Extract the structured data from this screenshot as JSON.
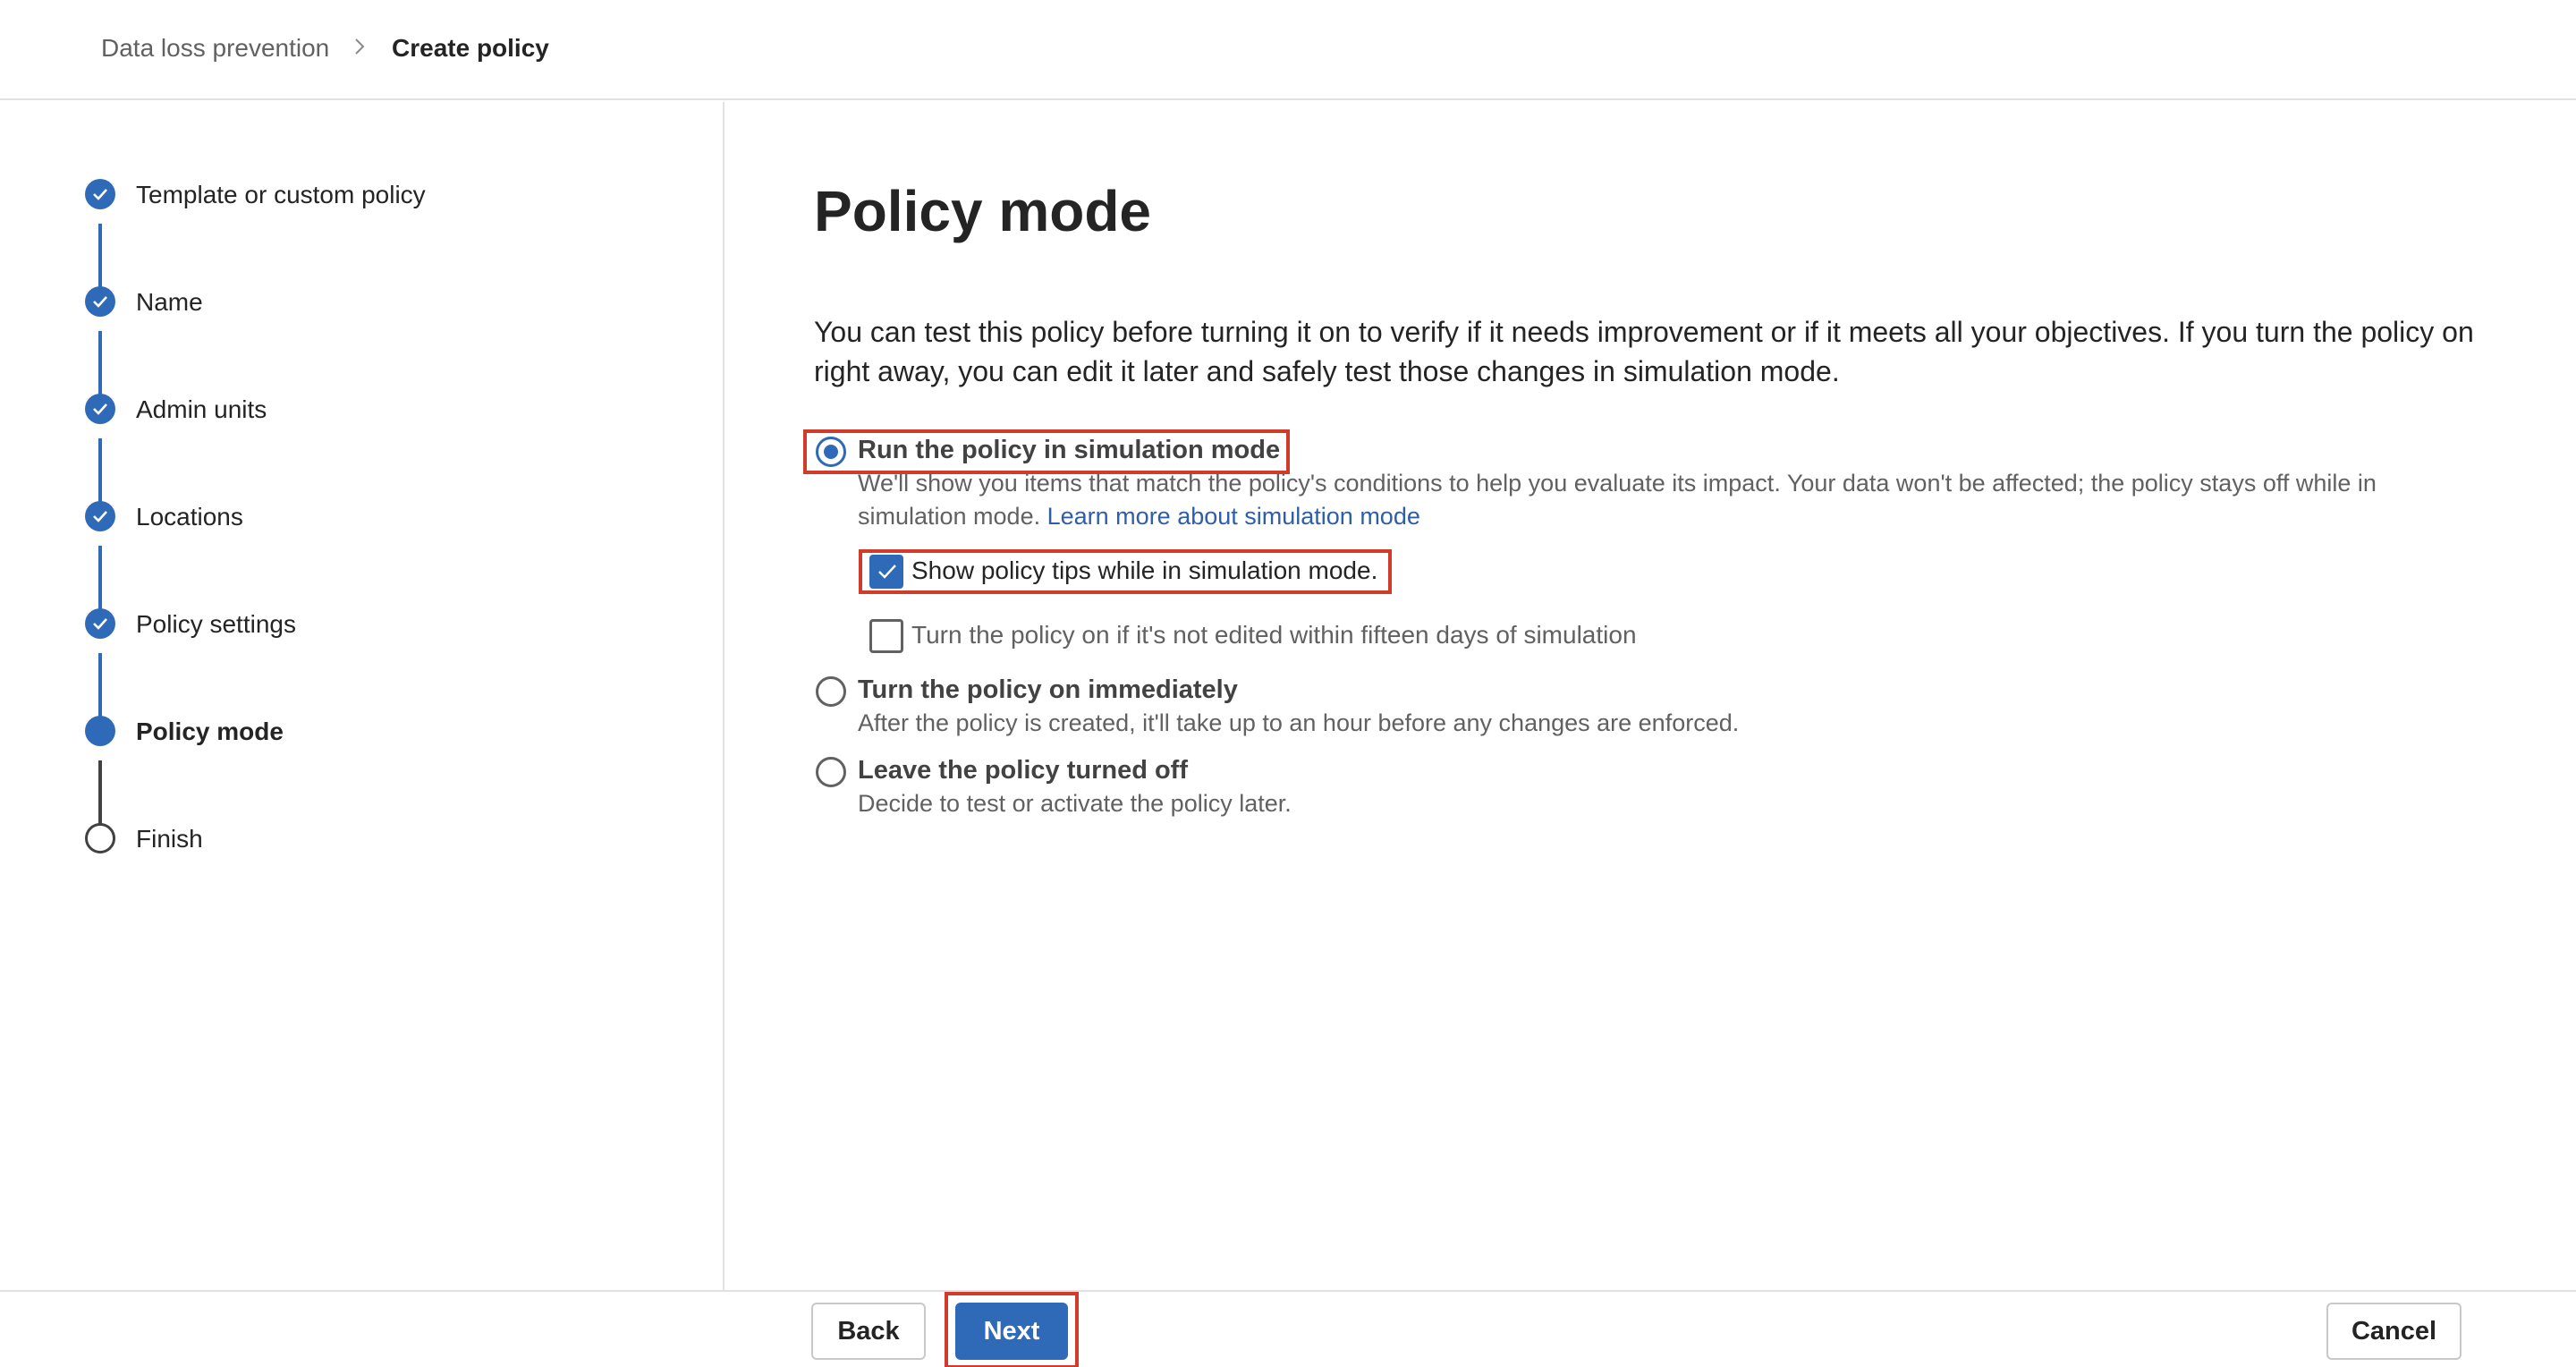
{
  "breadcrumb": {
    "items": [
      "Data loss prevention",
      "Create policy"
    ]
  },
  "wizard": {
    "steps": [
      {
        "label": "Template or custom policy",
        "state": "done"
      },
      {
        "label": "Name",
        "state": "done"
      },
      {
        "label": "Admin units",
        "state": "done"
      },
      {
        "label": "Locations",
        "state": "done"
      },
      {
        "label": "Policy settings",
        "state": "done"
      },
      {
        "label": "Policy mode",
        "state": "current"
      },
      {
        "label": "Finish",
        "state": "todo"
      }
    ]
  },
  "main": {
    "title": "Policy mode",
    "intro": "You can test this policy before turning it on to verify if it needs improvement or if it meets all your objectives. If you turn the policy on right away, you can edit it later and safely test those changes in simulation mode.",
    "options": [
      {
        "title": "Run the policy in simulation mode",
        "description": "We'll show you items that match the policy's conditions to help you evaluate its impact. Your data won't be affected; the policy stays off while in simulation mode.",
        "link": "Learn more about simulation mode",
        "selected": true
      },
      {
        "title": "Turn the policy on immediately",
        "description": "After the policy is created, it'll take up to an hour before any changes are enforced.",
        "selected": false
      },
      {
        "title": "Leave the policy turned off",
        "description": "Decide to test or activate the policy later.",
        "selected": false
      }
    ],
    "checkboxes": [
      {
        "label": "Show policy tips while in simulation mode.",
        "checked": true
      },
      {
        "label": "Turn the policy on if it's not edited within fifteen days of simulation",
        "checked": false
      }
    ]
  },
  "footer": {
    "back_label": "Back",
    "next_label": "Next",
    "cancel_label": "Cancel"
  },
  "colors": {
    "accent": "#2f6ab8",
    "highlight": "#d13b2a"
  },
  "icons": {
    "breadcrumb_separator": "chevron-right-icon",
    "step_done": "checkmark-icon"
  }
}
